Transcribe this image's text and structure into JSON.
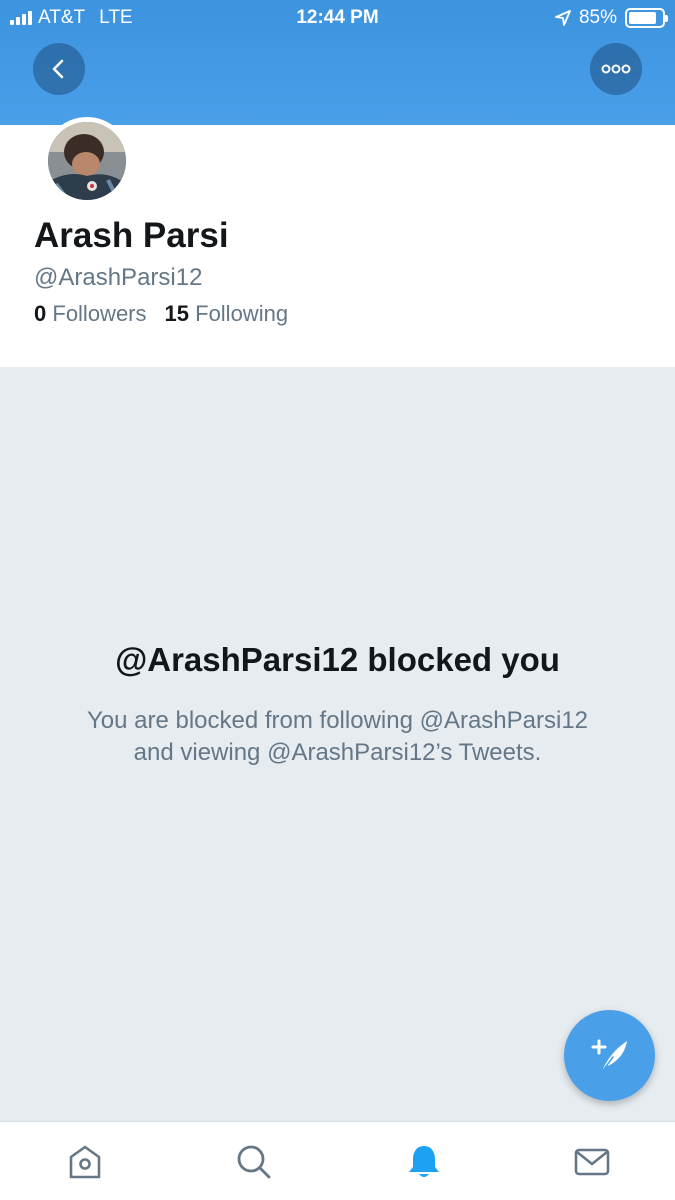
{
  "status_bar": {
    "carrier": "AT&T",
    "network": "LTE",
    "time": "12:44 PM",
    "battery_percent": "85%",
    "battery_level": 0.85
  },
  "header": {
    "back_icon": "chevron-left-icon",
    "more_icon": "more-horizontal-icon"
  },
  "profile": {
    "name": "Arash Parsi",
    "handle": "@ArashParsi12",
    "followers_count": "0",
    "followers_label": "Followers",
    "following_count": "15",
    "following_label": "Following"
  },
  "blocked": {
    "title": "@ArashParsi12 blocked you",
    "line1": "You are blocked from following @ArashParsi12",
    "line2": "and viewing @ArashParsi12’s Tweets."
  },
  "compose": {
    "icon": "compose-tweet-icon"
  },
  "tab_bar": {
    "items": [
      {
        "icon": "home-icon",
        "active": false
      },
      {
        "icon": "search-icon",
        "active": false
      },
      {
        "icon": "bell-icon",
        "active": true
      },
      {
        "icon": "envelope-icon",
        "active": false
      }
    ]
  },
  "colors": {
    "brand": "#4a9fe9",
    "background": "#e6ecf0",
    "text_primary": "#14171a",
    "text_secondary": "#657786",
    "tab_inactive": "#657786",
    "tab_active": "#1da1f2"
  }
}
